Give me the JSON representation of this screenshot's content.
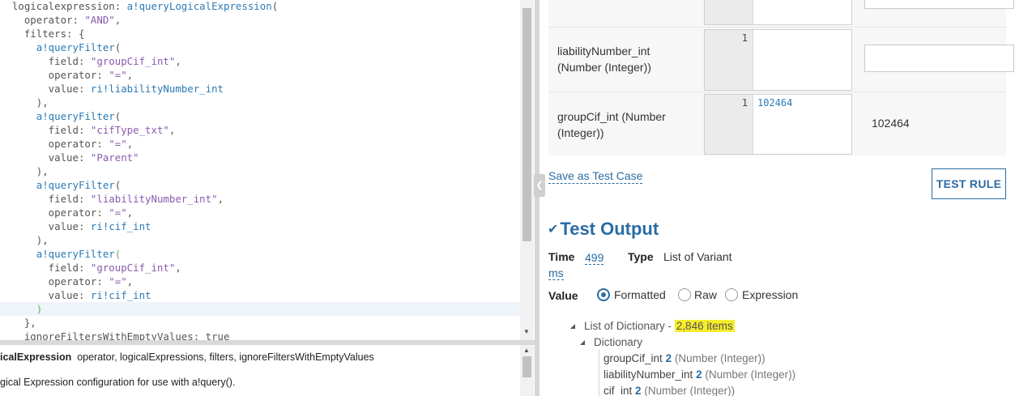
{
  "editor": {
    "lines": [
      [
        {
          "t": "  logicalexpression: ",
          "c": "key"
        },
        {
          "t": "a!queryLogicalExpression",
          "c": "fn"
        },
        {
          "t": "(",
          "c": "punc"
        }
      ],
      [
        {
          "t": "    operator: ",
          "c": "key"
        },
        {
          "t": "\"AND\"",
          "c": "str"
        },
        {
          "t": ",",
          "c": "punc"
        }
      ],
      [
        {
          "t": "    filters: {",
          "c": "key"
        }
      ],
      [
        {
          "t": "      ",
          "c": "key"
        },
        {
          "t": "a!queryFilter",
          "c": "fn"
        },
        {
          "t": "(",
          "c": "punc"
        }
      ],
      [
        {
          "t": "        field: ",
          "c": "key"
        },
        {
          "t": "\"groupCif_int\"",
          "c": "str"
        },
        {
          "t": ",",
          "c": "punc"
        }
      ],
      [
        {
          "t": "        operator: ",
          "c": "key"
        },
        {
          "t": "\"=\"",
          "c": "str"
        },
        {
          "t": ",",
          "c": "punc"
        }
      ],
      [
        {
          "t": "        value: ",
          "c": "key"
        },
        {
          "t": "ri!liabilityNumber_int",
          "c": "ref"
        }
      ],
      [
        {
          "t": "      ),",
          "c": "punc"
        }
      ],
      [
        {
          "t": "      ",
          "c": "key"
        },
        {
          "t": "a!queryFilter",
          "c": "fn"
        },
        {
          "t": "(",
          "c": "punc"
        }
      ],
      [
        {
          "t": "        field: ",
          "c": "key"
        },
        {
          "t": "\"cifType_txt\"",
          "c": "str"
        },
        {
          "t": ",",
          "c": "punc"
        }
      ],
      [
        {
          "t": "        operator: ",
          "c": "key"
        },
        {
          "t": "\"=\"",
          "c": "str"
        },
        {
          "t": ",",
          "c": "punc"
        }
      ],
      [
        {
          "t": "        value: ",
          "c": "key"
        },
        {
          "t": "\"Parent\"",
          "c": "str"
        }
      ],
      [
        {
          "t": "      ),",
          "c": "punc"
        }
      ],
      [
        {
          "t": "      ",
          "c": "key"
        },
        {
          "t": "a!queryFilter",
          "c": "fn"
        },
        {
          "t": "(",
          "c": "punc"
        }
      ],
      [
        {
          "t": "        field: ",
          "c": "key"
        },
        {
          "t": "\"liabilityNumber_int\"",
          "c": "str"
        },
        {
          "t": ",",
          "c": "punc"
        }
      ],
      [
        {
          "t": "        operator: ",
          "c": "key"
        },
        {
          "t": "\"=\"",
          "c": "str"
        },
        {
          "t": ",",
          "c": "punc"
        }
      ],
      [
        {
          "t": "        value: ",
          "c": "key"
        },
        {
          "t": "ri!cif_int",
          "c": "ref"
        }
      ],
      [
        {
          "t": "      ),",
          "c": "punc"
        }
      ],
      [
        {
          "t": "      ",
          "c": "key"
        },
        {
          "t": "a!queryFilter",
          "c": "fn"
        },
        {
          "t": "(",
          "c": "paren-hl"
        }
      ],
      [
        {
          "t": "        field: ",
          "c": "key"
        },
        {
          "t": "\"groupCif_int\"",
          "c": "str"
        },
        {
          "t": ",",
          "c": "punc"
        }
      ],
      [
        {
          "t": "        operator: ",
          "c": "key"
        },
        {
          "t": "\"=\"",
          "c": "str"
        },
        {
          "t": ",",
          "c": "punc"
        }
      ],
      [
        {
          "t": "        value: ",
          "c": "key"
        },
        {
          "t": "ri!cif_int",
          "c": "ref"
        }
      ],
      [
        {
          "t": "      ",
          "c": "key"
        },
        {
          "t": ")",
          "c": "paren-hl"
        }
      ],
      [
        {
          "t": "    },",
          "c": "punc"
        }
      ],
      [
        {
          "t": "    ignoreFiltersWithEmptyValues: true",
          "c": "key"
        }
      ]
    ],
    "active_line": 22
  },
  "doc": {
    "fn_name": "icalExpression",
    "params": "operator, logicalExpressions, filters, ignoreFiltersWithEmptyValues",
    "description": "gical Expression configuration for use with a!query()."
  },
  "inputs": {
    "rows": [
      {
        "label": "liabilityNumber_int (Number (Integer))",
        "line_number": "1",
        "expression": "",
        "value": "",
        "has_field": true
      },
      {
        "label": "groupCif_int (Number (Integer))",
        "line_number": "1",
        "expression": "102464",
        "value": "102464",
        "has_field": false
      }
    ]
  },
  "actions": {
    "save_test_case": "Save as Test Case",
    "test_rule": "TEST RULE"
  },
  "output": {
    "title": "Test Output",
    "time_label": "Time",
    "time_value": "499",
    "time_unit": "ms",
    "type_label": "Type",
    "type_value": "List of Variant",
    "value_label": "Value",
    "modes": [
      "Formatted",
      "Raw",
      "Expression"
    ],
    "selected_mode": "Formatted",
    "tree": {
      "root_label": "List of Dictionary - ",
      "root_count": "2,846 items",
      "child_label": "Dictionary",
      "fields": [
        {
          "name": "groupCif_int",
          "value": "2",
          "type": "(Number (Integer))"
        },
        {
          "name": "liabilityNumber_int",
          "value": "2",
          "type": "(Number (Integer))"
        },
        {
          "name": "cif_int",
          "value": "2",
          "type": "(Number (Integer))"
        }
      ]
    }
  },
  "colors": {
    "accent": "#2b6ca3",
    "highlight": "#f6ec2b",
    "string": "#8a5ab0",
    "function": "#2b7ab5"
  }
}
